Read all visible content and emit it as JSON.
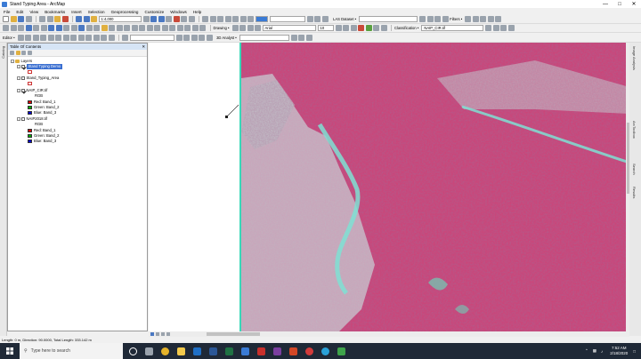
{
  "window": {
    "title": "Stand Typing Area - ArcMap"
  },
  "menu": [
    "File",
    "Edit",
    "View",
    "Bookmarks",
    "Insert",
    "Selection",
    "Geoprocessing",
    "Customize",
    "Windows",
    "Help"
  ],
  "toolbars": {
    "scale": "1:4,000",
    "las_dataset_label": "LAS Dataset •",
    "filters_label": "Filters •",
    "editor_label": "Editor •",
    "drawing_label": "Drawing •",
    "font_name": "Arial",
    "font_size": "10",
    "classification_label": "Classification •",
    "classification_layer": "NAIP_CIR.tif",
    "analyst_3d_label": "3D Analyst •"
  },
  "toc": {
    "title": "Table Of Contents",
    "layers_root": "Layers",
    "items": [
      {
        "label": "Stand Typing Demo",
        "selected": true
      },
      {
        "label": "Stand_Typing_Area"
      },
      {
        "label": "NAIP_CIR.tif"
      },
      {
        "label": "RGB"
      },
      {
        "label": "Red: Band_1"
      },
      {
        "label": "Green: Band_2"
      },
      {
        "label": "Blue: Band_3"
      },
      {
        "label": "NAIP2018.tif"
      },
      {
        "label": "RGB"
      },
      {
        "label": "Red: Band_1"
      },
      {
        "label": "Green: Band_2"
      },
      {
        "label": "Blue: Band_3"
      }
    ]
  },
  "side_tabs": {
    "left": "Catalog",
    "right": [
      "Image Analysis",
      "ArcToolbox",
      "Search",
      "Results"
    ]
  },
  "status_bar": {
    "text": "Length: 0 m, Direction: 90.0000, Total Length: 333.142 m"
  },
  "taskbar": {
    "search_placeholder": "Type here to search",
    "time": "7:52 AM",
    "date": "2/18/2020"
  },
  "colors": {
    "red_band": "#e00000",
    "green_band": "#00b000",
    "blue_band": "#0000d0",
    "map_vegetation": "#c23a6e",
    "map_road": "#7fe0d4"
  }
}
